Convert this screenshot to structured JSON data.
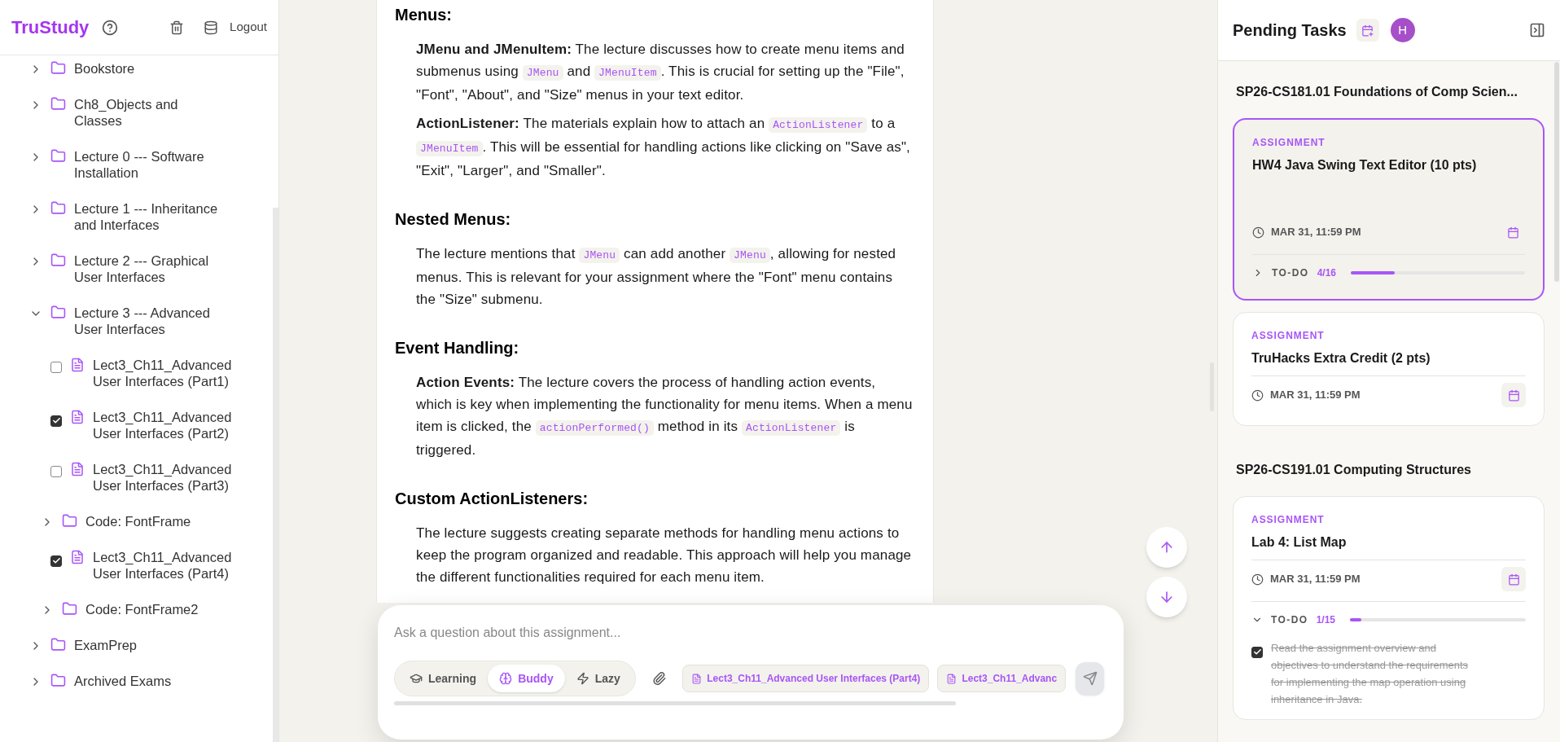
{
  "app": {
    "name": "TruStudy",
    "logout": "Logout"
  },
  "tree": [
    {
      "kind": "folder",
      "label": "Bookstore",
      "expanded": false
    },
    {
      "kind": "folder",
      "label": "Ch8_Objects and Classes",
      "expanded": false
    },
    {
      "kind": "folder",
      "label": "Lecture 0 --- Software Installation",
      "expanded": false
    },
    {
      "kind": "folder",
      "label": "Lecture 1 --- Inheritance and Interfaces",
      "expanded": false
    },
    {
      "kind": "folder",
      "label": "Lecture 2 --- Graphical User Interfaces",
      "expanded": false
    },
    {
      "kind": "folder",
      "label": "Lecture 3 --- Advanced User Interfaces",
      "expanded": true,
      "children": [
        {
          "kind": "file",
          "label": "Lect3_Ch11_Advanced User Interfaces (Part1)",
          "checked": false
        },
        {
          "kind": "file",
          "label": "Lect3_Ch11_Advanced User Interfaces (Part2)",
          "checked": true
        },
        {
          "kind": "file",
          "label": "Lect3_Ch11_Advanced User Interfaces (Part3)",
          "checked": false
        },
        {
          "kind": "folder",
          "label": "Code: FontFrame",
          "expanded": false
        },
        {
          "kind": "file",
          "label": "Lect3_Ch11_Advanced User Interfaces (Part4)",
          "checked": true
        },
        {
          "kind": "folder",
          "label": "Code: FontFrame2",
          "expanded": false
        }
      ]
    },
    {
      "kind": "folder",
      "label": "ExamPrep",
      "expanded": false
    },
    {
      "kind": "folder",
      "label": "Archived Exams",
      "expanded": false
    }
  ],
  "document": {
    "sections": [
      {
        "heading": "Menus:",
        "paragraphs": [
          [
            {
              "kind": "bold",
              "text": "JMenu and JMenuItem:"
            },
            {
              "kind": "text",
              "text": " The lecture discusses how to create menu items and submenus using "
            },
            {
              "kind": "code",
              "text": "JMenu"
            },
            {
              "kind": "text",
              "text": " and "
            },
            {
              "kind": "code",
              "text": "JMenuItem"
            },
            {
              "kind": "text",
              "text": ". This is crucial for setting up the \"File\", \"Font\", \"About\", and \"Size\" menus in your text editor."
            }
          ],
          [
            {
              "kind": "bold",
              "text": "ActionListener:"
            },
            {
              "kind": "text",
              "text": " The materials explain how to attach an "
            },
            {
              "kind": "code",
              "text": "ActionListener"
            },
            {
              "kind": "text",
              "text": " to a "
            },
            {
              "kind": "code",
              "text": "JMenuItem"
            },
            {
              "kind": "text",
              "text": ". This will be essential for handling actions like clicking on \"Save as\", \"Exit\", \"Larger\", and \"Smaller\"."
            }
          ]
        ]
      },
      {
        "heading": "Nested Menus:",
        "paragraphs": [
          [
            {
              "kind": "text",
              "text": "The lecture mentions that "
            },
            {
              "kind": "code",
              "text": "JMenu"
            },
            {
              "kind": "text",
              "text": " can add another "
            },
            {
              "kind": "code",
              "text": "JMenu"
            },
            {
              "kind": "text",
              "text": ", allowing for nested menus. This is relevant for your assignment where the \"Font\" menu contains the \"Size\" submenu."
            }
          ]
        ]
      },
      {
        "heading": "Event Handling:",
        "paragraphs": [
          [
            {
              "kind": "bold",
              "text": "Action Events:"
            },
            {
              "kind": "text",
              "text": " The lecture covers the process of handling action events, which is key when implementing the functionality for menu items. When a menu item is clicked, the "
            },
            {
              "kind": "code",
              "text": "actionPerformed()"
            },
            {
              "kind": "text",
              "text": " method in its "
            },
            {
              "kind": "code",
              "text": "ActionListener"
            },
            {
              "kind": "text",
              "text": " is triggered."
            }
          ]
        ]
      },
      {
        "heading": "Custom ActionListeners:",
        "paragraphs": [
          [
            {
              "kind": "text",
              "text": "The lecture suggests creating separate methods for handling menu actions to keep the program organized and readable. This approach will help you manage the different functionalities required for each menu item."
            }
          ]
        ]
      }
    ]
  },
  "chat": {
    "placeholder": "Ask a question about this assignment...",
    "modes": [
      {
        "label": "Learning",
        "selected": false
      },
      {
        "label": "Buddy",
        "selected": true
      },
      {
        "label": "Lazy",
        "selected": false
      }
    ],
    "attachments": [
      "Lect3_Ch11_Advanced User Interfaces (Part4)",
      "Lect3_Ch11_Advanc"
    ]
  },
  "tasks_panel": {
    "title": "Pending Tasks",
    "avatar": "H",
    "courses": [
      {
        "name": "SP26-CS181.01 Foundations of Comp Scien...",
        "tasks": [
          {
            "type": "ASSIGNMENT",
            "title": "HW4 Java Swing Text Editor (10 pts)",
            "due": "MAR 31, 11:59 PM",
            "selected": true,
            "todo": {
              "label": "TO-DO",
              "count": "4/16",
              "level": 0.25,
              "expanded": false
            }
          },
          {
            "type": "ASSIGNMENT",
            "title": "TruHacks Extra Credit (2 pts)",
            "due": "MAR 31, 11:59 PM",
            "selected": false
          }
        ]
      },
      {
        "name": "SP26-CS191.01 Computing Structures",
        "tasks": [
          {
            "type": "ASSIGNMENT",
            "title": "Lab 4: List Map",
            "due": "MAR 31, 11:59 PM",
            "selected": false,
            "todo": {
              "label": "TO-DO",
              "count": "1/15",
              "level": 0.067,
              "expanded": true,
              "items": [
                {
                  "text": "Read the assignment overview and objectives to understand the requirements for implementing the map operation using inheritance in Java.",
                  "checked": true
                }
              ]
            }
          }
        ]
      }
    ]
  }
}
